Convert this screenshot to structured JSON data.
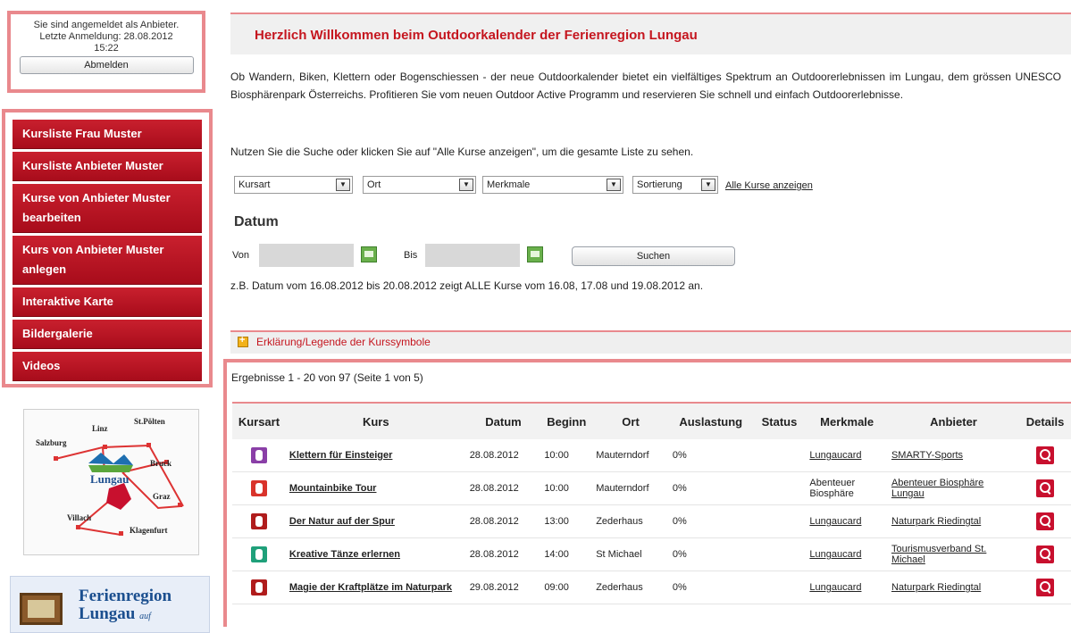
{
  "login": {
    "line1": "Sie sind angemeldet als Anbieter.",
    "line2": "Letzte Anmeldung: 28.08.2012",
    "line3": "15:22",
    "logout_label": "Abmelden"
  },
  "sidebar": {
    "items": [
      {
        "label": "Kursliste Frau Muster"
      },
      {
        "label": "Kursliste Anbieter Muster"
      },
      {
        "label": "Kurse von Anbieter Muster bearbeiten"
      },
      {
        "label": "Kurs von Anbieter Muster anlegen"
      },
      {
        "label": "Interaktive Karte"
      },
      {
        "label": "Bildergalerie"
      },
      {
        "label": "Videos"
      }
    ]
  },
  "map": {
    "labels": [
      "Linz",
      "St.Pölten",
      "Salzburg",
      "Lungau",
      "Bruck",
      "Graz",
      "Villach",
      "Klagenfurt"
    ]
  },
  "promo": {
    "title_line1": "Ferienregion",
    "title_line2": "Lungau",
    "suffix": "auf"
  },
  "header": {
    "title": "Herzlich Willkommen beim Outdoorkalender der Ferienregion Lungau"
  },
  "intro": "Ob Wandern, Biken, Klettern oder Bogenschiessen - der neue Outdoorkalender bietet ein vielfältiges Spektrum an Outdoorerlebnissen im Lungau, dem grössen UNESCO Biosphärenpark Österreichs. Profitieren Sie vom neuen Outdoor Active Programm und reservieren Sie schnell und einfach Outdoorerlebnisse.",
  "hint": "Nutzen Sie die Suche oder klicken Sie auf \"Alle Kurse anzeigen\", um die gesamte Liste zu sehen.",
  "filters": {
    "kursart": "Kursart",
    "ort": "Ort",
    "merkmale": "Merkmale",
    "sortierung": "Sortierung",
    "all_link": "Alle Kurse anzeigen"
  },
  "datum": {
    "title": "Datum",
    "von_label": "Von",
    "bis_label": "Bis",
    "search_label": "Suchen",
    "example": "z.B. Datum vom 16.08.2012 bis 20.08.2012 zeigt ALLE Kurse vom 16.08, 17.08 und 19.08.2012 an."
  },
  "legend": {
    "label": "Erklärung/Legende der Kurssymbole"
  },
  "results": {
    "count": "Ergebnisse 1 - 20 von 97 (Seite 1 von 5)",
    "headers": [
      "Kursart",
      "Kurs",
      "Datum",
      "Beginn",
      "Ort",
      "Auslastung",
      "Status",
      "Merkmale",
      "Anbieter",
      "Details"
    ],
    "rows": [
      {
        "icon": "climbing-icon",
        "color": "#8a3fa7",
        "kurs": "Klettern für Einsteiger",
        "datum": "28.08.2012",
        "beginn": "10:00",
        "ort": "Mauterndorf",
        "auslastung": "0%",
        "status": "",
        "merkmale": "Lungaucard",
        "merkmale_link": true,
        "anbieter": "SMARTY-Sports"
      },
      {
        "icon": "bike-icon",
        "color": "#d9332b",
        "kurs": "Mountainbike Tour",
        "datum": "28.08.2012",
        "beginn": "10:00",
        "ort": "Mauterndorf",
        "auslastung": "0%",
        "status": "",
        "merkmale": "Abenteuer Biosphäre",
        "merkmale_link": false,
        "anbieter": "Abenteuer Biosphäre Lungau"
      },
      {
        "icon": "hiking-icon",
        "color": "#b01c1c",
        "kurs": "Der Natur auf der Spur",
        "datum": "28.08.2012",
        "beginn": "13:00",
        "ort": "Zederhaus",
        "auslastung": "0%",
        "status": "",
        "merkmale": "Lungaucard",
        "merkmale_link": true,
        "anbieter": "Naturpark Riedingtal"
      },
      {
        "icon": "dance-icon",
        "color": "#1fa07a",
        "kurs": "Kreative Tänze erlernen",
        "datum": "28.08.2012",
        "beginn": "14:00",
        "ort": "St Michael",
        "auslastung": "0%",
        "status": "",
        "merkmale": "Lungaucard",
        "merkmale_link": true,
        "anbieter": "Tourismusverband St. Michael"
      },
      {
        "icon": "hiking-icon",
        "color": "#b01c1c",
        "kurs": "Magie der Kraftplätze im Naturpark",
        "datum": "29.08.2012",
        "beginn": "09:00",
        "ort": "Zederhaus",
        "auslastung": "0%",
        "status": "",
        "merkmale": "Lungaucard",
        "merkmale_link": true,
        "anbieter": "Naturpark Riedingtal"
      }
    ]
  }
}
